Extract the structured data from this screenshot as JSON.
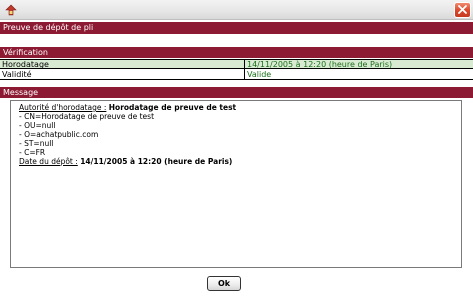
{
  "window": {
    "title": ""
  },
  "icons": {
    "app": "app-icon",
    "close": "close-icon"
  },
  "dialog": {
    "title": "Preuve de dépôt de pli"
  },
  "verification": {
    "header": "Vérification",
    "rows": [
      {
        "label": "Horodatage",
        "value": "14/11/2005 à 12:20 (heure de Paris)"
      },
      {
        "label": "Validité",
        "value": "Valide"
      }
    ]
  },
  "message": {
    "header": "Message",
    "authority_label": "Autorité d'horodatage :",
    "authority_value": "Horodatage de preuve de test",
    "details": [
      "- CN=Horodatage de preuve de test",
      "- OU=null",
      "- O=achatpublic.com",
      "- ST=null",
      "- C=FR"
    ],
    "date_label": "Date du dépôt :",
    "date_value": "14/11/2005 à 12:20 (heure de Paris)"
  },
  "buttons": {
    "ok": "Ok"
  },
  "colors": {
    "header_bg": "#8d1a33",
    "value_text": "#1a6f1a",
    "highlight_row": "#d9ead3"
  }
}
